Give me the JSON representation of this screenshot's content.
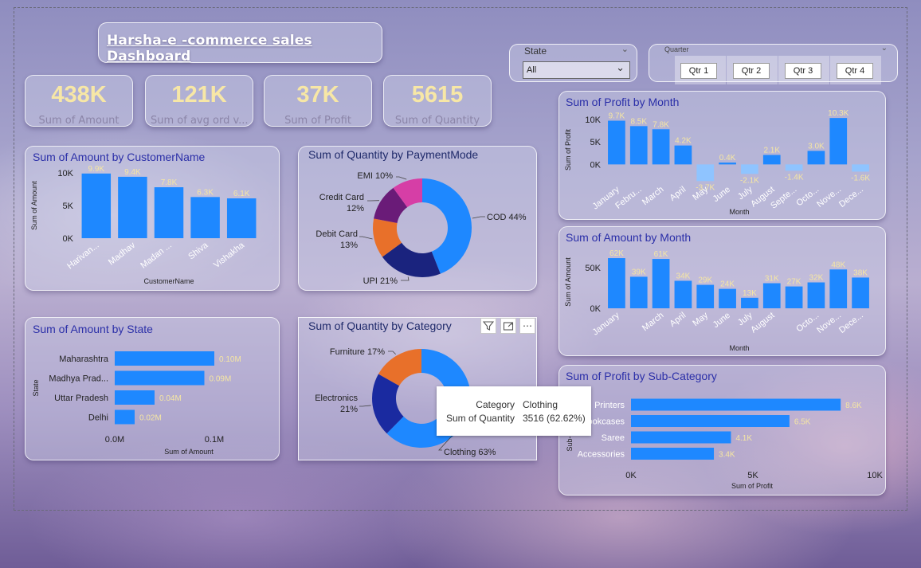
{
  "dashboard": {
    "title": "Harsha-e -commerce sales Dashboard"
  },
  "kpis": [
    {
      "value": "438K",
      "label": "Sum of Amount"
    },
    {
      "value": "121K",
      "label": "Sum of avg ord v..."
    },
    {
      "value": "37K",
      "label": "Sum of Profit"
    },
    {
      "value": "5615",
      "label": "Sum of Quantity"
    }
  ],
  "slicers": {
    "state": {
      "title": "State",
      "selected": "All"
    },
    "quarter": {
      "title": "Quarter",
      "options": [
        "Qtr 1",
        "Qtr 2",
        "Qtr 3",
        "Qtr 4"
      ]
    }
  },
  "tooltip": {
    "category_key": "Category",
    "category_value": "Clothing",
    "quantity_key": "Sum of Quantity",
    "quantity_value": "3516 (62.62%)"
  },
  "colors": {
    "bar": "#1e88ff",
    "neg_bar": "#8fc4ff",
    "label": "#f5e6a3",
    "title": "#2b2fa8",
    "kpi": "#f7e7a6",
    "cod": "#1e88ff",
    "upi": "#1a237e",
    "debit": "#e8702a",
    "credit": "#6a1b78",
    "emi": "#d63ea6",
    "clothing": "#1e88ff",
    "electronics": "#1a2aa0",
    "furniture": "#e8702a"
  },
  "icons": [
    "filter-icon",
    "focus-mode-icon",
    "more-options-icon",
    "chevron-down-icon"
  ],
  "chart_data": [
    {
      "id": "amount_by_customer",
      "type": "bar",
      "title": "Sum of Amount by CustomerName",
      "xlabel": "CustomerName",
      "ylabel": "Sum of Amount",
      "categories": [
        "Harivan...",
        "Madhav",
        "Madan ...",
        "Shiva",
        "Vishakha"
      ],
      "values": [
        9900,
        9400,
        7800,
        6300,
        6100
      ],
      "labels": [
        "9.9K",
        "9.4K",
        "7.8K",
        "6.3K",
        "6.1K"
      ],
      "yticks": [
        "0K",
        "5K",
        "10K"
      ],
      "ylim": [
        0,
        10000
      ]
    },
    {
      "id": "quantity_by_paymentmode",
      "type": "pie",
      "donut": true,
      "title": "Sum of Quantity by PaymentMode",
      "slices": [
        {
          "name": "COD",
          "value": 44,
          "label": "COD 44%"
        },
        {
          "name": "UPI",
          "value": 21,
          "label": "UPI 21%"
        },
        {
          "name": "Debit Card",
          "value": 13,
          "label1": "Debit Card",
          "label2": "13%"
        },
        {
          "name": "Credit Card",
          "value": 12,
          "label1": "Credit Card",
          "label2": "12%"
        },
        {
          "name": "EMI",
          "value": 10,
          "label": "EMI 10%"
        }
      ]
    },
    {
      "id": "amount_by_state",
      "type": "bar",
      "orientation": "horizontal",
      "title": "Sum of Amount by State",
      "xlabel": "Sum of Amount",
      "ylabel": "State",
      "categories": [
        "Maharashtra",
        "Madhya Prad...",
        "Uttar Pradesh",
        "Delhi"
      ],
      "values": [
        0.1,
        0.09,
        0.04,
        0.02
      ],
      "labels": [
        "0.10M",
        "0.09M",
        "0.04M",
        "0.02M"
      ],
      "xticks": [
        "0.0M",
        "0.1M"
      ],
      "xlim": [
        0,
        0.1
      ]
    },
    {
      "id": "quantity_by_category",
      "type": "pie",
      "donut": true,
      "title": "Sum of Quantity by Category",
      "slices": [
        {
          "name": "Clothing",
          "value": 63,
          "label": "Clothing 63%"
        },
        {
          "name": "Electronics",
          "value": 21,
          "label1": "Electronics",
          "label2": "21%"
        },
        {
          "name": "Furniture",
          "value": 17,
          "label": "Furniture 17%"
        }
      ]
    },
    {
      "id": "profit_by_month",
      "type": "bar",
      "title": "Sum of Profit by Month",
      "xlabel": "Month",
      "ylabel": "Sum of Profit",
      "categories": [
        "January",
        "Febru...",
        "March",
        "April",
        "May",
        "June",
        "July",
        "August",
        "Septe...",
        "Octo...",
        "Nove...",
        "Dece..."
      ],
      "values": [
        9700,
        8500,
        7800,
        4200,
        -3700,
        400,
        -2100,
        2100,
        -1400,
        3000,
        10300,
        -1600
      ],
      "labels": [
        "9.7K",
        "8.5K",
        "7.8K",
        "4.2K",
        "-3.7K",
        "0.4K",
        "-2.1K",
        "2.1K",
        "-1.4K",
        "3.0K",
        "10.3K",
        "-1.6K"
      ],
      "yticks": [
        "0K",
        "5K",
        "10K"
      ],
      "ylim": [
        -4000,
        10500
      ]
    },
    {
      "id": "amount_by_month",
      "type": "bar",
      "title": "Sum of Amount by Month",
      "xlabel": "Month",
      "ylabel": "Sum of Amount",
      "categories": [
        "January",
        "March",
        "April",
        "May",
        "June",
        "July",
        "August",
        "Octo...",
        "Nove...",
        "Dece..."
      ],
      "values": [
        62000,
        39000,
        61000,
        34000,
        29000,
        24000,
        13000,
        31000,
        27000,
        32000,
        48000,
        38000
      ],
      "labels": [
        "62K",
        "39K",
        "61K",
        "34K",
        "29K",
        "24K",
        "13K",
        "31K",
        "27K",
        "32K",
        "48K",
        "38K"
      ],
      "tick_labels": [
        "January",
        "",
        "March",
        "April",
        "May",
        "June",
        "July",
        "August",
        "",
        "Octo...",
        "Nove...",
        "Dece..."
      ],
      "yticks": [
        "0K",
        "50K"
      ],
      "ylim": [
        0,
        65000
      ]
    },
    {
      "id": "profit_by_subcategory",
      "type": "bar",
      "orientation": "horizontal",
      "title": "Sum of Profit by Sub-Category",
      "xlabel": "Sum of Profit",
      "ylabel": "Sub-",
      "categories": [
        "Printers",
        "ookcases",
        "Saree",
        "Accessories"
      ],
      "values": [
        8600,
        6500,
        4100,
        3400
      ],
      "labels": [
        "8.6K",
        "6.5K",
        "4.1K",
        "3.4K"
      ],
      "xticks": [
        "0K",
        "5K",
        "10K"
      ],
      "xlim": [
        0,
        10000
      ]
    }
  ]
}
